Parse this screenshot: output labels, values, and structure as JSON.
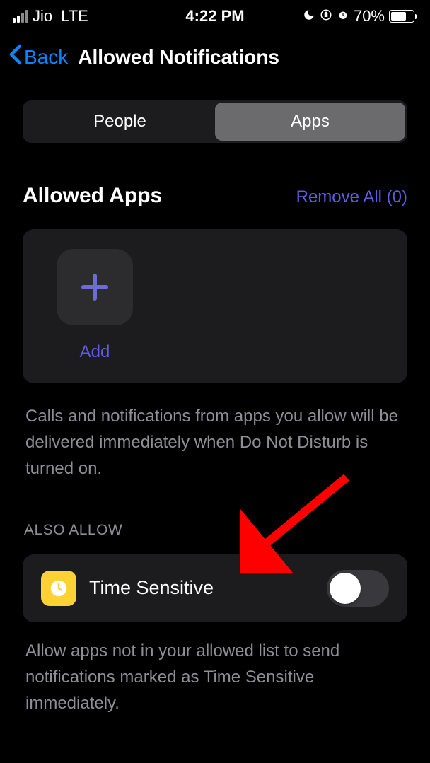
{
  "status": {
    "carrier": "Jio",
    "network": "LTE",
    "time": "4:22 PM",
    "battery_percent": "70%"
  },
  "nav": {
    "back_label": "Back",
    "title": "Allowed Notifications"
  },
  "segments": {
    "people": "People",
    "apps": "Apps",
    "active": "apps"
  },
  "allowed_apps": {
    "title": "Allowed Apps",
    "remove_all": "Remove All (0)",
    "add_label": "Add",
    "description": "Calls and notifications from apps you allow will be delivered immediately when Do Not Disturb is turned on."
  },
  "also_allow": {
    "header": "ALSO ALLOW",
    "time_sensitive_label": "Time Sensitive",
    "time_sensitive_enabled": false,
    "description": "Allow apps not in your allowed list to send notifications marked as Time Sensitive immediately."
  }
}
